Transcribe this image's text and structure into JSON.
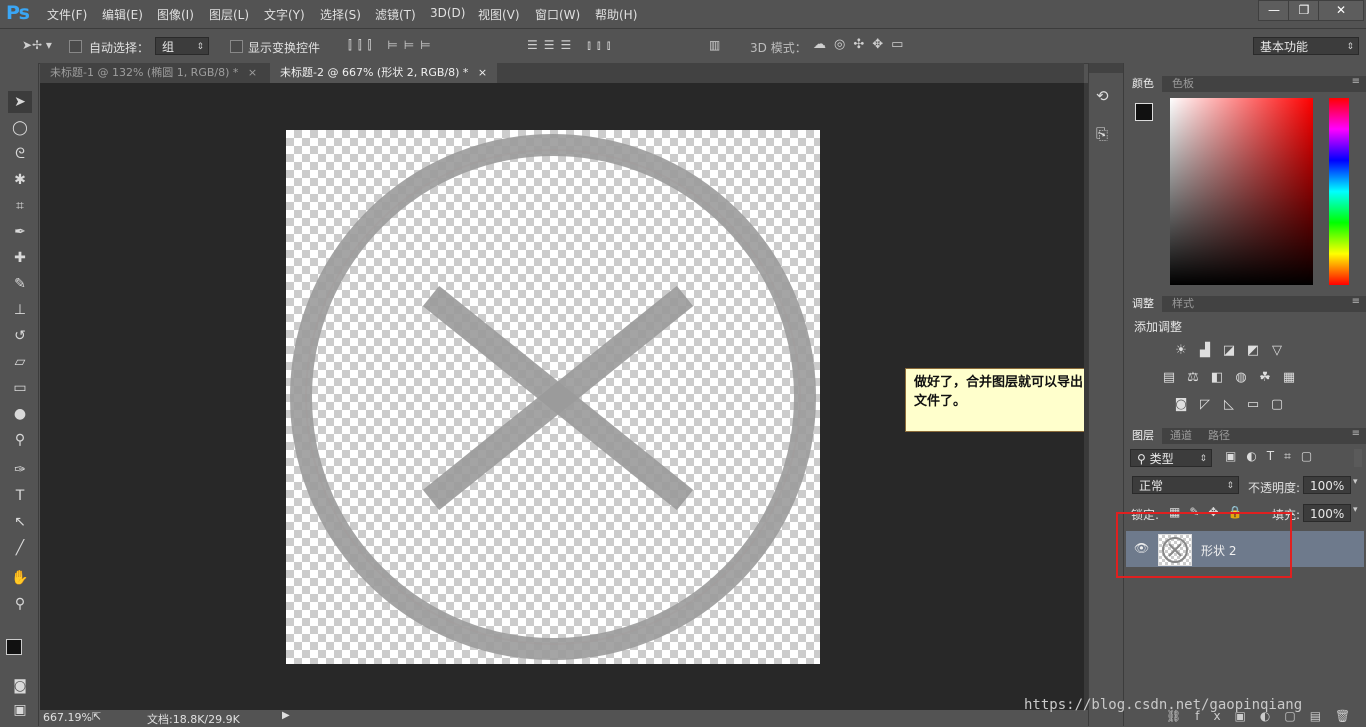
{
  "app": {
    "logo": "Ps"
  },
  "menu": [
    "文件(F)",
    "编辑(E)",
    "图像(I)",
    "图层(L)",
    "文字(Y)",
    "选择(S)",
    "滤镜(T)",
    "3D(D)",
    "视图(V)",
    "窗口(W)",
    "帮助(H)"
  ],
  "window_controls": {
    "minimize": "—",
    "restore": "❐",
    "close": "✕"
  },
  "options_bar": {
    "auto_select_label": "自动选择：",
    "auto_select_value": "组",
    "show_transform_label": "显示变换控件",
    "mode_3d_label": "3D 模式：",
    "workspace": "基本功能"
  },
  "tabs": [
    {
      "label": "未标题-1 @ 132% (椭圆 1, RGB/8) *",
      "close": "×",
      "active": false
    },
    {
      "label": "未标题-2 @ 667% (形状 2, RGB/8) *",
      "close": "×",
      "active": true
    }
  ],
  "note": {
    "text": "做好了，合并图层就可以导出文件了。"
  },
  "status": {
    "zoom": "667.19%",
    "doc": "文档:18.8K/29.9K"
  },
  "color_panel": {
    "tabs": [
      "颜色",
      "色板"
    ],
    "active": "颜色"
  },
  "adjust_panel": {
    "tabs": [
      "调整",
      "样式"
    ],
    "title": "添加调整"
  },
  "layers_panel": {
    "tabs": [
      "图层",
      "通道",
      "路径"
    ],
    "filter_kind": "类型",
    "blend_mode": "正常",
    "opacity_label": "不透明度:",
    "opacity": "100%",
    "lock_label": "锁定:",
    "fill_label": "填充:",
    "fill": "100%",
    "layers": [
      {
        "name": "形状 2",
        "visible": true
      }
    ]
  },
  "watermark": "https://blog.csdn.net/gaopinqiang",
  "colors": {
    "shape_gray": "#9b9b9b",
    "highlight_red": "#e02020",
    "note_bg": "#ffffcc",
    "layer_selected": "#6e7a8c"
  }
}
